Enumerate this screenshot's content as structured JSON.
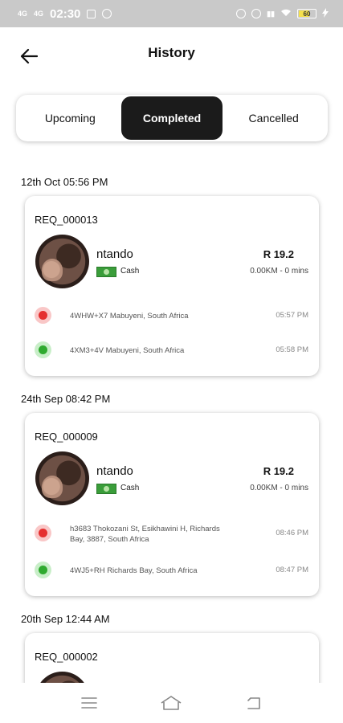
{
  "status_bar": {
    "signal_left_1": "4G",
    "signal_left_2": "4G",
    "time": "02:30",
    "battery_level": "60"
  },
  "header": {
    "title": "History"
  },
  "tabs": [
    {
      "label": "Upcoming",
      "active": false
    },
    {
      "label": "Completed",
      "active": true
    },
    {
      "label": "Cancelled",
      "active": false
    }
  ],
  "trips": [
    {
      "date": "12th Oct 05:56 PM",
      "request_id": "REQ_000013",
      "driver_name": "ntando",
      "payment": "Cash",
      "fare": "R 19.2",
      "distance_time": "0.00KM - 0 mins",
      "pickup_address": "4WHW+X7 Mabuyeni, South Africa",
      "pickup_time": "05:57 PM",
      "drop_address": "4XM3+4V Mabuyeni, South Africa",
      "drop_time": "05:58 PM"
    },
    {
      "date": "24th Sep 08:42 PM",
      "request_id": "REQ_000009",
      "driver_name": "ntando",
      "payment": "Cash",
      "fare": "R 19.2",
      "distance_time": "0.00KM - 0 mins",
      "pickup_address": "h3683 Thokozani St, Esikhawini H, Richards Bay, 3887, South Africa",
      "pickup_time": "08:46 PM",
      "drop_address": "4WJ5+RH Richards Bay, South Africa",
      "drop_time": "08:47 PM"
    },
    {
      "date": "20th Sep 12:44 AM",
      "request_id": "REQ_000002"
    }
  ],
  "colors": {
    "active_tab_bg": "#1b1b1b",
    "pickup_dot": "#e52e2e",
    "drop_dot": "#2faa2f",
    "status_bar_bg": "#c9c9c9"
  },
  "icons": {
    "back": "arrow-left-icon",
    "menu": "menu-icon",
    "home": "home-icon",
    "back_nav": "back-nav-icon"
  }
}
